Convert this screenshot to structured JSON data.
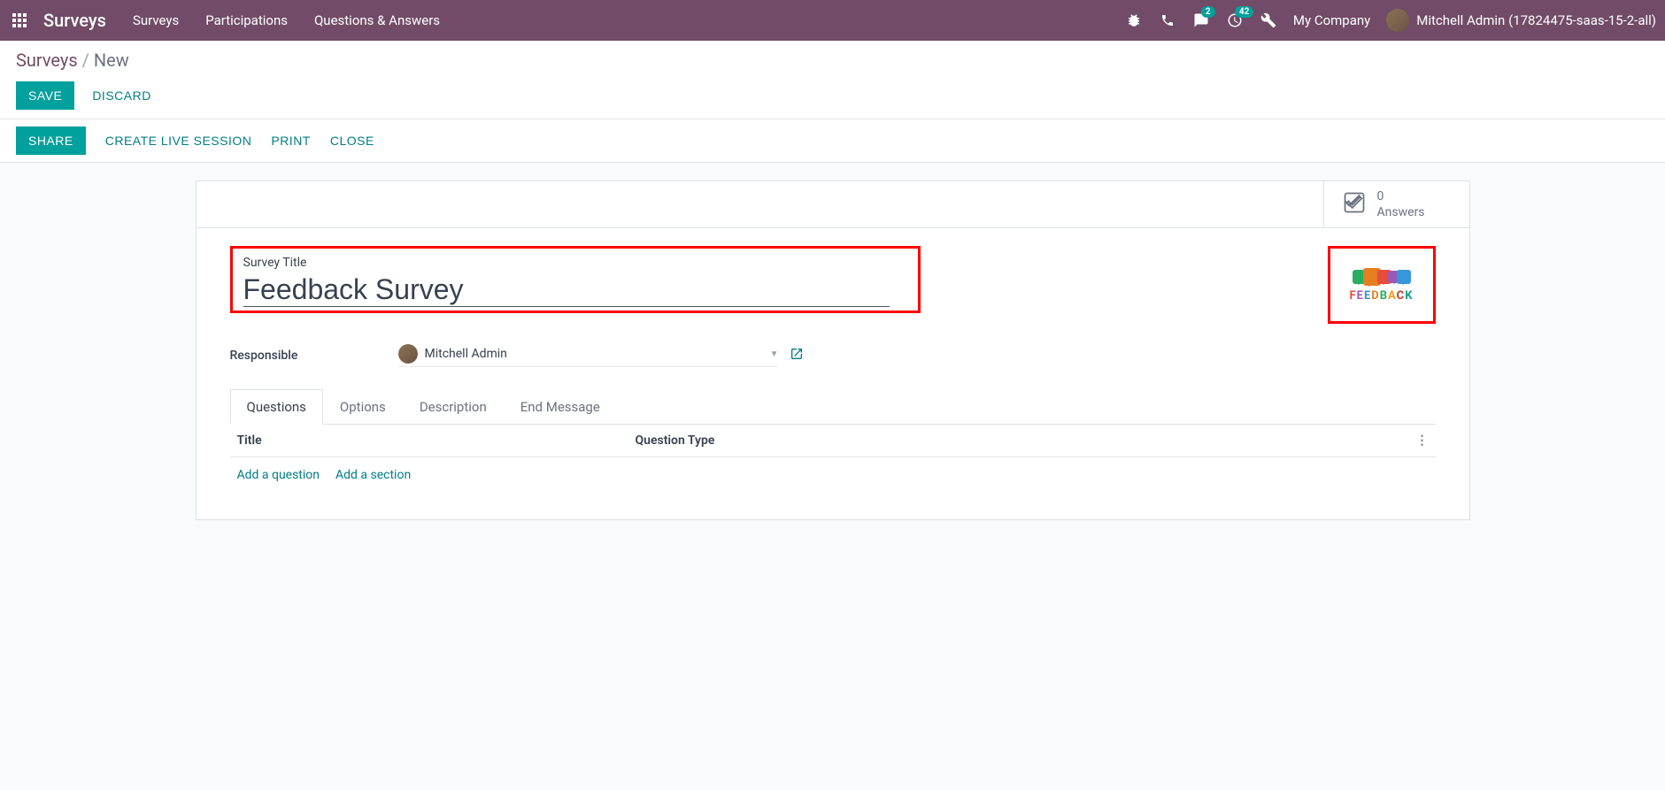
{
  "nav": {
    "brand": "Surveys",
    "menu": [
      "Surveys",
      "Participations",
      "Questions & Answers"
    ],
    "messages_badge": "2",
    "activities_badge": "42",
    "company": "My Company",
    "user": "Mitchell Admin (17824475-saas-15-2-all)"
  },
  "breadcrumb": {
    "root": "Surveys",
    "current": "New"
  },
  "buttons": {
    "save": "SAVE",
    "discard": "DISCARD"
  },
  "actions": {
    "share": "SHARE",
    "create_session": "CREATE LIVE SESSION",
    "print": "PRINT",
    "close": "CLOSE"
  },
  "stat": {
    "count": "0",
    "label": "Answers"
  },
  "form": {
    "title_label": "Survey Title",
    "title_value": "Feedback Survey",
    "responsible_label": "Responsible",
    "responsible_value": "Mitchell Admin"
  },
  "tabs": [
    "Questions",
    "Options",
    "Description",
    "End Message"
  ],
  "table": {
    "col_title": "Title",
    "col_type": "Question Type",
    "add_question": "Add a question",
    "add_section": "Add a section"
  },
  "feedback_word": "FEEDBACK"
}
